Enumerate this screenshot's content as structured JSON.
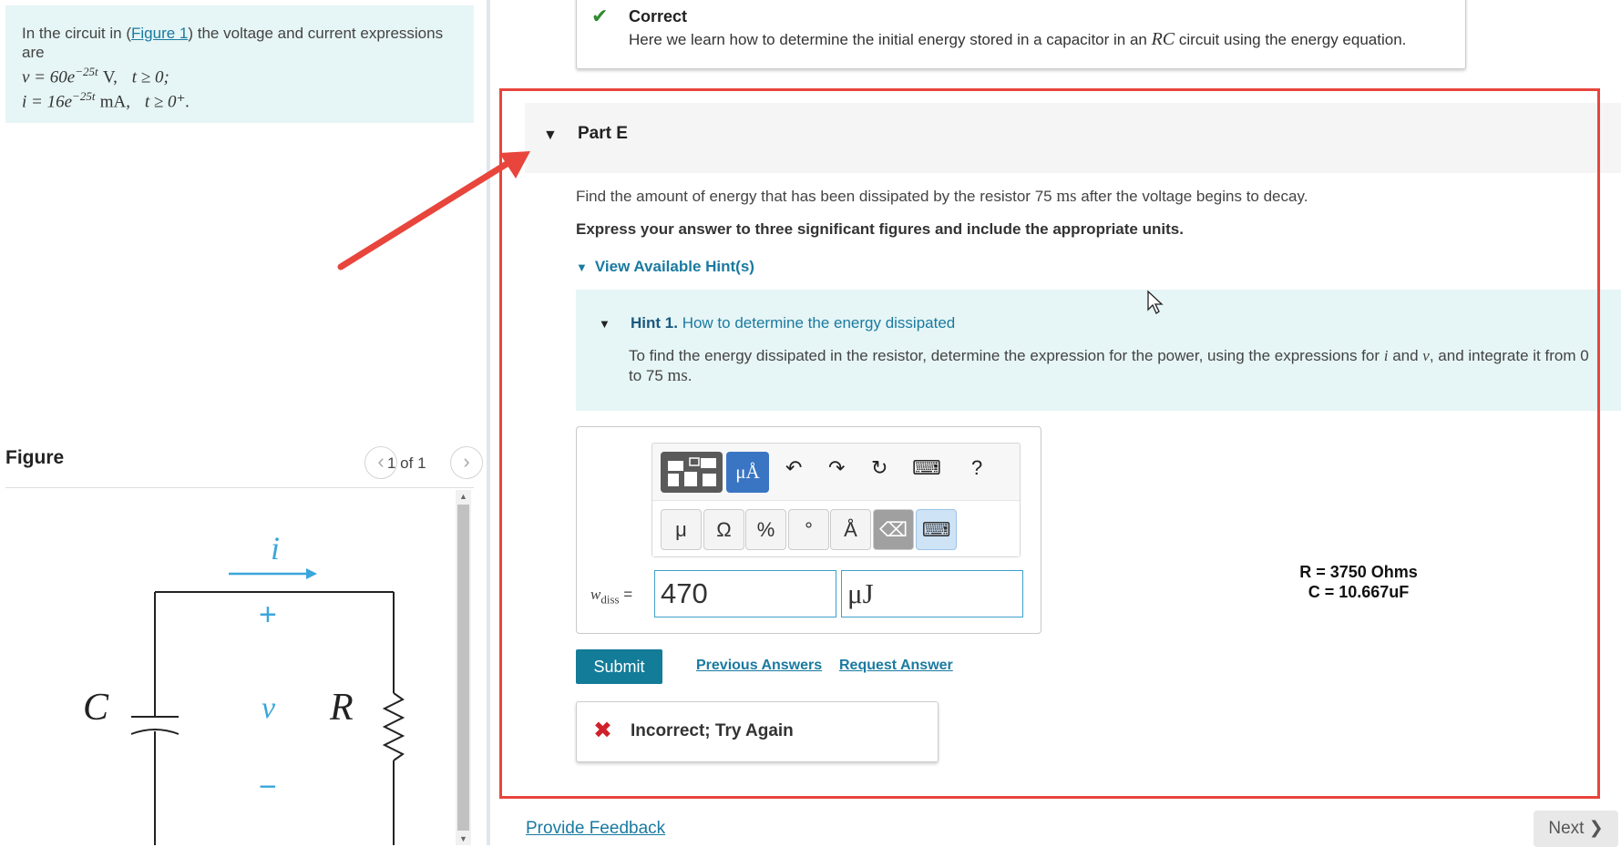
{
  "problem": {
    "intro_prefix": "In the circuit in (",
    "figure_link": "Figure 1",
    "intro_suffix": ") the voltage and current expressions are",
    "v_expr": "v = 60e",
    "v_exp": "−25t",
    "v_unit": "V,",
    "v_cond": "t ≥ 0;",
    "i_expr": "i = 16e",
    "i_exp": "−25t",
    "i_unit": "mA,",
    "i_cond": "t ≥ 0⁺."
  },
  "figure": {
    "label": "Figure",
    "pager": "1 of 1",
    "prev": "‹",
    "next": "›",
    "i_label": "i",
    "c_label": "C",
    "v_label": "v",
    "r_label": "R",
    "plus": "+",
    "minus": "−"
  },
  "correct": {
    "title": "Correct",
    "text_prefix": "Here we learn how to determine the initial energy stored in a capacitor in an ",
    "text_math": "RC",
    "text_suffix": " circuit using the energy equation."
  },
  "part": {
    "title": "Part E",
    "question_prefix": "Find the amount of energy that has been dissipated by the resistor 75 ",
    "question_unit": "ms",
    "question_suffix": " after the voltage begins to decay.",
    "instructions": "Express your answer to three significant figures and include the appropriate units.",
    "hints_toggle": "View Available Hint(s)"
  },
  "hint": {
    "number": "Hint 1.",
    "title": "How to determine the energy dissipated",
    "body_1": "To find the energy dissipated in the resistor, determine the expression for the power, using the expressions for ",
    "body_i": "i",
    "body_2": " and ",
    "body_v": "v",
    "body_3": ", and integrate it from 0 to 75 ",
    "body_unit": "ms",
    "body_4": "."
  },
  "toolbar": {
    "units_label": "μÅ",
    "undo": "↶",
    "redo": "↷",
    "reset": "↻",
    "keyboard": "⌨",
    "help": "?",
    "symbols": [
      "μ",
      "Ω",
      "%",
      "°",
      "Å"
    ],
    "backspace": "⌫"
  },
  "answer": {
    "label_var": "w",
    "label_sub": "diss",
    "label_eq": " =",
    "value": "470",
    "unit": "μJ"
  },
  "actions": {
    "submit": "Submit",
    "previous_answers": "Previous Answers",
    "request_answer": "Request Answer"
  },
  "feedback": {
    "incorrect": "Incorrect; Try Again",
    "provide_feedback": "Provide Feedback",
    "next": "Next ❯"
  },
  "annotation": {
    "r_value": "R = 3750 Ohms",
    "c_value": "C = 10.667uF"
  },
  "colors": {
    "accent": "#137c98",
    "link": "#1a7aa0",
    "highlight": "#e8453c",
    "correct": "#2e8b2e",
    "incorrect": "#d0202a",
    "figure_blue": "#3aa6dc"
  }
}
